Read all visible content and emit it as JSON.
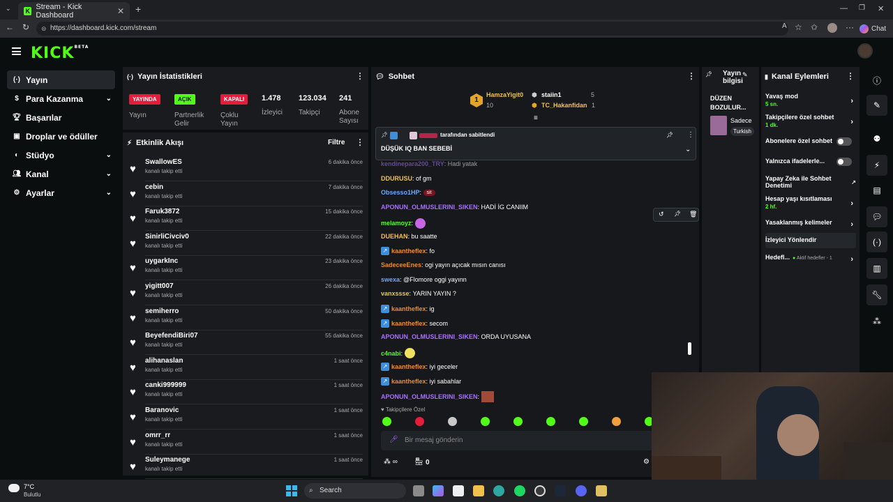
{
  "browser": {
    "tab_title": "Stream - Kick Dashboard",
    "url": "https://dashboard.kick.com/stream",
    "chat_button": "Chat",
    "reader_label": "A"
  },
  "header": {
    "logo": "KICK",
    "logo_tag": "BETA"
  },
  "sidebar": {
    "items": [
      {
        "label": "Yayın",
        "icon": "broadcast-icon",
        "active": true,
        "expandable": false
      },
      {
        "label": "Para Kazanma",
        "icon": "dollar-icon",
        "active": false,
        "expandable": true
      },
      {
        "label": "Başarılar",
        "icon": "trophy-icon",
        "active": false,
        "expandable": false
      },
      {
        "label": "Droplar ve ödüller",
        "icon": "gift-icon",
        "active": false,
        "expandable": false
      },
      {
        "label": "Stüdyo",
        "icon": "palette-icon",
        "active": false,
        "expandable": true
      },
      {
        "label": "Kanal",
        "icon": "users-icon",
        "active": false,
        "expandable": true
      },
      {
        "label": "Ayarlar",
        "icon": "gear-icon",
        "active": false,
        "expandable": true
      }
    ]
  },
  "stats": {
    "title": "Yayın İstatistikleri",
    "live_badge": "YAYINDA",
    "live_label": "Yayın",
    "partner_badge": "AÇIK",
    "partner_label": "Partnerlik Gelir",
    "multi_badge": "KAPALI",
    "multi_label": "Çoklu Yayın",
    "viewers": "1.478",
    "viewers_label": "İzleyici",
    "followers": "123.034",
    "followers_label": "Takipçi",
    "subs": "241",
    "subs_label": "Abone Sayısı"
  },
  "feed": {
    "title": "Etkinlik Akışı",
    "filter_label": "Filtre",
    "items": [
      {
        "name": "SwallowES",
        "action": "kanalı takip etti",
        "time": "6 dakika önce"
      },
      {
        "name": "cebin",
        "action": "kanalı takip etti",
        "time": "7 dakika önce"
      },
      {
        "name": "Faruk3872",
        "action": "kanalı takip etti",
        "time": "15 dakika önce"
      },
      {
        "name": "SinirliCivciv0",
        "action": "kanalı takip etti",
        "time": "22 dakika önce"
      },
      {
        "name": "uygarkInc",
        "action": "kanalı takip etti",
        "time": "23 dakika önce"
      },
      {
        "name": "yigitt007",
        "action": "kanalı takip etti",
        "time": "26 dakika önce"
      },
      {
        "name": "semiherro",
        "action": "kanalı takip etti",
        "time": "50 dakika önce"
      },
      {
        "name": "BeyefendiBiri07",
        "action": "kanalı takip etti",
        "time": "55 dakika önce"
      },
      {
        "name": "alihanaslan",
        "action": "kanalı takip etti",
        "time": "1 saat önce"
      },
      {
        "name": "canki999999",
        "action": "kanalı takip etti",
        "time": "1 saat önce"
      },
      {
        "name": "Baranovic",
        "action": "kanalı takip etti",
        "time": "1 saat önce"
      },
      {
        "name": "omrr_rr",
        "action": "kanalı takip etti",
        "time": "1 saat önce"
      },
      {
        "name": "Suleymanege",
        "action": "kanalı takip etti",
        "time": "1 saat önce"
      }
    ]
  },
  "chat": {
    "title": "Sohbet",
    "leaderboard": [
      {
        "rank": "1",
        "name": "HamzaYigit0",
        "count": "10"
      },
      {
        "name": "staiin1",
        "count": "5"
      },
      {
        "name": "TC_Hakanfidan",
        "count": "1"
      }
    ],
    "pinned_by": "tarafından sabitlendi",
    "pinned_text": "DÜŞÜK IQ BAN SEBEBİ",
    "messages": [
      {
        "user": "kendinepara200_TRY",
        "text": "Hadi yatak",
        "color": "#a970ff",
        "badge": false
      },
      {
        "user": "DDURUSU",
        "text": "of gm",
        "color": "#f0c24b",
        "badge": false
      },
      {
        "user": "Obsesso1HP",
        "text": "sit",
        "color": "#6aa9ff",
        "badge": false
      },
      {
        "user": "APONUN_OLMUSLERINI_SIKEN",
        "text": "HADİ İG CANIIM",
        "color": "#a970ff",
        "badge": false
      },
      {
        "user": "melamoyz",
        "text": "",
        "color": "#53fc18",
        "badge": false
      },
      {
        "user": "DUEHAN",
        "text": "bu saatte",
        "color": "#f0c24b",
        "badge": false
      },
      {
        "user": "kaantheflex",
        "text": "fo",
        "color": "#f08c28",
        "badge": true
      },
      {
        "user": "SadeceeEnes",
        "text": "ogi yayın açıcak mısın canısı",
        "color": "#f08c28",
        "badge": false
      },
      {
        "user": "swexa",
        "text": "@Flomore oggi yayınn",
        "color": "#6aa9ff",
        "badge": false
      },
      {
        "user": "vanxssse",
        "text": "YARIN YAYIN ?",
        "color": "#f0c24b",
        "badge": false
      },
      {
        "user": "kaantheflex",
        "text": "ig",
        "color": "#f08c28",
        "badge": true
      },
      {
        "user": "kaantheflex",
        "text": "secom",
        "color": "#f08c28",
        "badge": true
      },
      {
        "user": "APONUN_OLMUSLERINI_SIKEN",
        "text": "ORDA UYUSANA",
        "color": "#a970ff",
        "badge": false
      },
      {
        "user": "c4nabi",
        "text": "",
        "color": "#53fc18",
        "badge": false
      },
      {
        "user": "kaantheflex",
        "text": "iyi geceler",
        "color": "#f08c28",
        "badge": true
      },
      {
        "user": "kaantheflex",
        "text": "iyi sabahlar",
        "color": "#f08c28",
        "badge": true
      },
      {
        "user": "APONUN_OLMUSLERINI_SIKEN",
        "text": "",
        "color": "#a970ff",
        "badge": false
      }
    ],
    "followers_only": "Takipçilere Özel",
    "input_placeholder": "Bir mesaj gönderin",
    "points": "0"
  },
  "stream_info": {
    "title": "Yayın bilgisi",
    "stream_title": "DÜZEN BOZULUR...",
    "category": "Sadece",
    "tag": "Turkish"
  },
  "actions": {
    "title": "Kanal Eylemleri",
    "slow_mode": "Yavaş mod",
    "slow_mode_value": "5 sn.",
    "followers_chat": "Takipçilere özel sohbet",
    "followers_chat_value": "1 dk.",
    "subs_chat": "Abonelere özel sohbet",
    "emotes_only": "Yalnızca ifadelerle...",
    "ai_moderation": "Yapay Zeka ile Sohbet Denetimi",
    "account_age": "Hesap yaşı kısıtlaması",
    "account_age_value": "2 hf.",
    "banned_words": "Yasaklanmış kelimeler",
    "raid": "İzleyici Yönlendir",
    "goals": "Hedefl...",
    "goals_status": "Aktif hedefler - 1"
  },
  "taskbar": {
    "weather_temp": "7°C",
    "weather_desc": "Bulutlu",
    "search": "Search"
  }
}
